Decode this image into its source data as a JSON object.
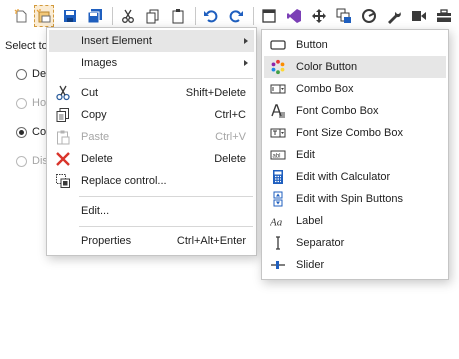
{
  "background": {
    "select_label": "Select to",
    "radios": [
      {
        "text": "Def",
        "checked": false,
        "disabled": false
      },
      {
        "text": "Hot",
        "checked": false,
        "disabled": true
      },
      {
        "text": "Colo",
        "checked": true,
        "disabled": false
      },
      {
        "text": "Dis",
        "checked": false,
        "disabled": true
      }
    ]
  },
  "toolbar": {
    "icons": [
      "new-element-icon",
      "paste-element-icon",
      "save-icon",
      "save-all-icon",
      "cut-icon",
      "copy-icon",
      "paste-icon",
      "undo-icon",
      "redo-icon",
      "form-icon",
      "visual-studio-icon",
      "move-icon",
      "layers-icon",
      "color-wheel-icon",
      "wrench-icon",
      "media-icon",
      "toolbox-icon",
      "briefcase-icon"
    ]
  },
  "context_menu": {
    "items": [
      {
        "label": "Insert Element",
        "shortcut": "",
        "submenu": true,
        "disabled": false,
        "icon": ""
      },
      {
        "label": "Images",
        "shortcut": "",
        "submenu": true,
        "disabled": false,
        "icon": ""
      },
      {
        "label": "Cut",
        "shortcut": "Shift+Delete",
        "submenu": false,
        "disabled": false,
        "icon": "scissors-icon"
      },
      {
        "label": "Copy",
        "shortcut": "Ctrl+C",
        "submenu": false,
        "disabled": false,
        "icon": "copy-icon"
      },
      {
        "label": "Paste",
        "shortcut": "Ctrl+V",
        "submenu": false,
        "disabled": true,
        "icon": "clipboard-icon"
      },
      {
        "label": "Delete",
        "shortcut": "Delete",
        "submenu": false,
        "disabled": false,
        "icon": "delete-x-icon"
      },
      {
        "label": "Replace control...",
        "shortcut": "",
        "submenu": false,
        "disabled": false,
        "icon": "replace-control-icon"
      },
      {
        "label": "Edit...",
        "shortcut": "",
        "submenu": false,
        "disabled": false,
        "icon": ""
      },
      {
        "label": "Properties",
        "shortcut": "Ctrl+Alt+Enter",
        "submenu": false,
        "disabled": false,
        "icon": ""
      }
    ]
  },
  "insert_submenu": {
    "items": [
      {
        "label": "Button",
        "icon": "button-icon"
      },
      {
        "label": "Color Button",
        "icon": "color-wheel-icon"
      },
      {
        "label": "Combo Box",
        "icon": "combo-box-icon"
      },
      {
        "label": "Font Combo Box",
        "icon": "font-combo-icon"
      },
      {
        "label": "Font Size Combo Box",
        "icon": "font-size-combo-icon"
      },
      {
        "label": "Edit",
        "icon": "edit-box-icon"
      },
      {
        "label": "Edit with Calculator",
        "icon": "calculator-icon"
      },
      {
        "label": "Edit with Spin Buttons",
        "icon": "spin-buttons-icon"
      },
      {
        "label": "Label",
        "icon": "label-icon"
      },
      {
        "label": "Separator",
        "icon": "separator-icon"
      },
      {
        "label": "Slider",
        "icon": "slider-icon"
      }
    ]
  },
  "colors": {
    "accent_blue": "#1f5fbf",
    "highlight": "#e6e6e6",
    "delete_red": "#d9342b"
  }
}
